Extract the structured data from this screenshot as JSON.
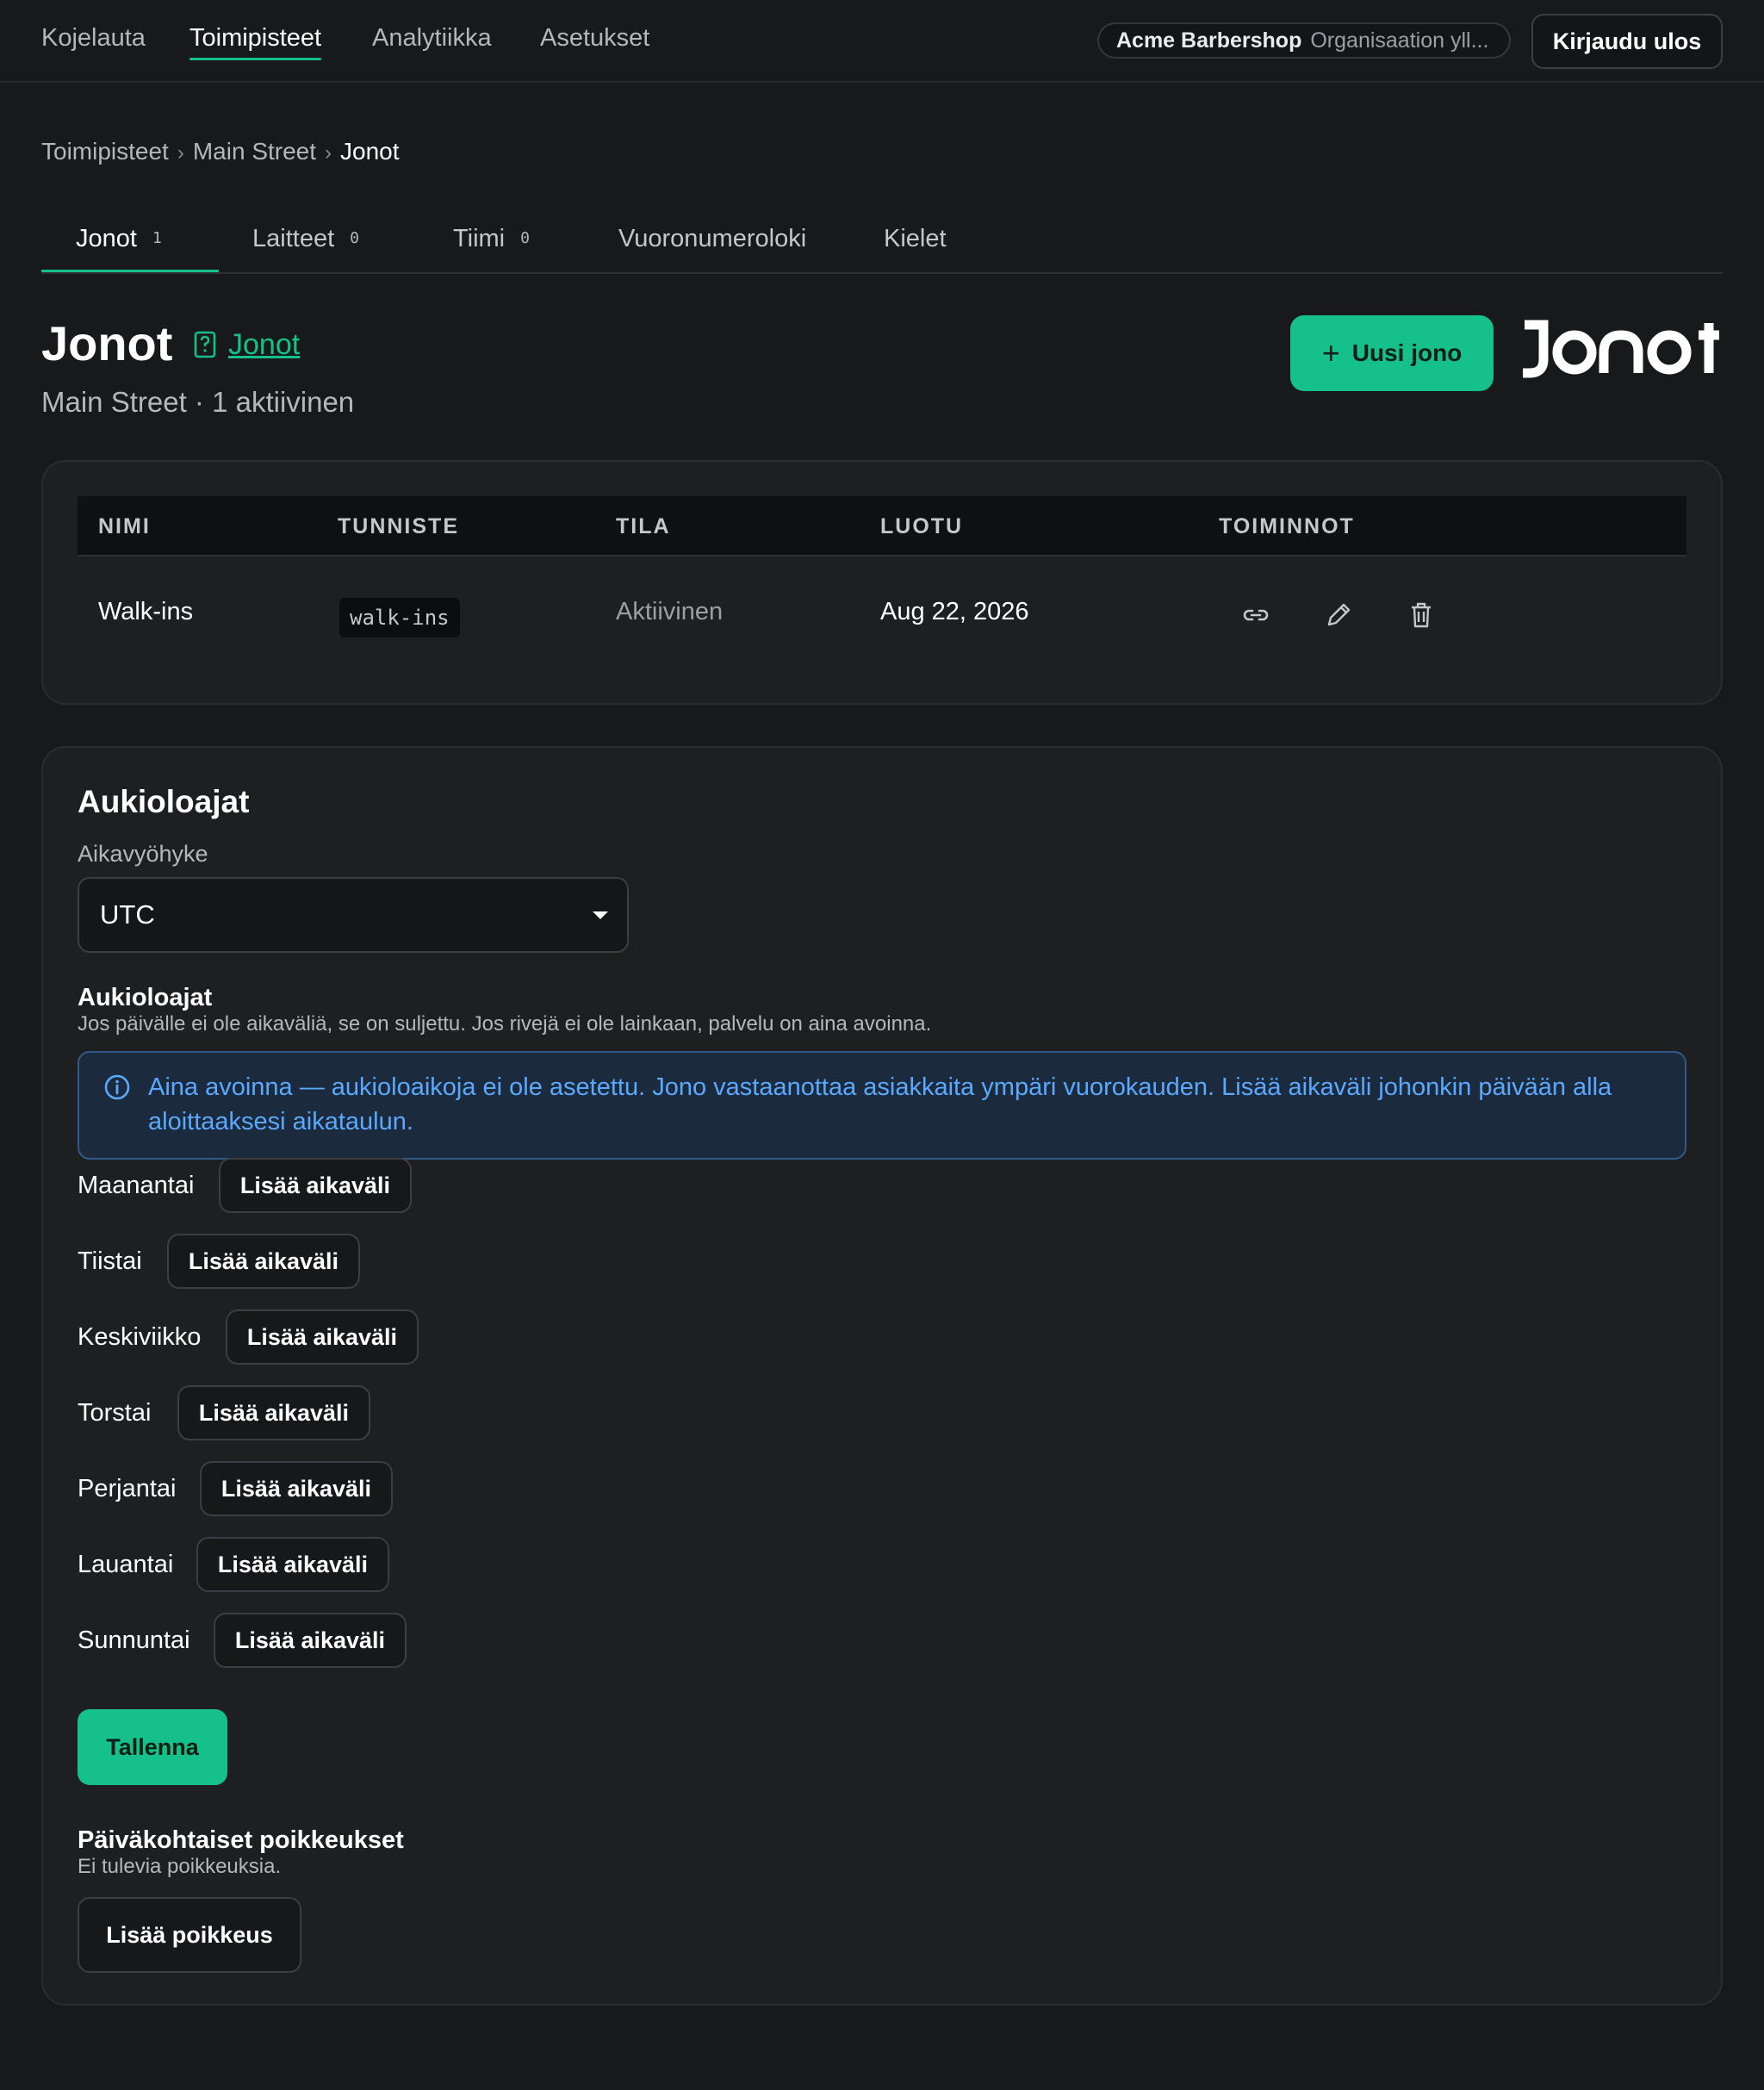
{
  "nav": {
    "items": [
      {
        "label": "Kojelauta"
      },
      {
        "label": "Toimipisteet"
      },
      {
        "label": "Analytiikka"
      },
      {
        "label": "Asetukset"
      }
    ],
    "active_index": 1,
    "org_name": "Acme Barbershop",
    "org_description": "Organisaation yll...",
    "logout_label": "Kirjaudu ulos"
  },
  "breadcrumb": [
    "Toimipisteet",
    "Main Street",
    "Jonot"
  ],
  "tabs": [
    {
      "label": "Jonot",
      "count": "1"
    },
    {
      "label": "Laitteet",
      "count": "0"
    },
    {
      "label": "Tiimi",
      "count": "0"
    },
    {
      "label": "Vuoronumeroloki"
    },
    {
      "label": "Kielet"
    }
  ],
  "header": {
    "title": "Jonot",
    "help_link": "Jonot",
    "subtitle": "Main Street · 1 aktiivinen",
    "new_button": "Uusi jono",
    "brand_logo": "JONOT"
  },
  "queues_table": {
    "columns": [
      "NIMI",
      "TUNNISTE",
      "TILA",
      "LUOTU",
      "TOIMINNOT"
    ],
    "rows": [
      {
        "name": "Walk-ins",
        "slug": "walk-ins",
        "status": "Aktiivinen",
        "created": "Aug 22, 2026",
        "actions": [
          "link-icon",
          "pencil-icon",
          "trash-icon"
        ]
      }
    ]
  },
  "hours": {
    "title": "Aukioloajat",
    "timezone_label": "Aikavyöhyke",
    "timezone_value": "UTC",
    "section_title": "Aukioloajat",
    "section_hint": "Jos päivälle ei ole aikaväliä, se on suljettu. Jos rivejä ei ole lainkaan, palvelu on aina avoinna.",
    "alert": "Aina avoinna — aukioloaikoja ei ole asetettu. Jono vastaanottaa asiakkaita ympäri vuorokauden. Lisää aikaväli johonkin päivään alla aloittaaksesi aikataulun.",
    "add_interval_label": "Lisää aikaväli",
    "days": [
      "Maanantai",
      "Tiistai",
      "Keskiviikko",
      "Torstai",
      "Perjantai",
      "Lauantai",
      "Sunnuntai"
    ],
    "save_label": "Tallenna",
    "exceptions_title": "Päiväkohtaiset poikkeukset",
    "exceptions_hint": "Ei tulevia poikkeuksia.",
    "add_exception_label": "Lisää poikkeus"
  },
  "colors": {
    "accent": "#16c08a",
    "background": "#18191b",
    "card": "#1d1f21",
    "info": "#5aa9ff"
  }
}
